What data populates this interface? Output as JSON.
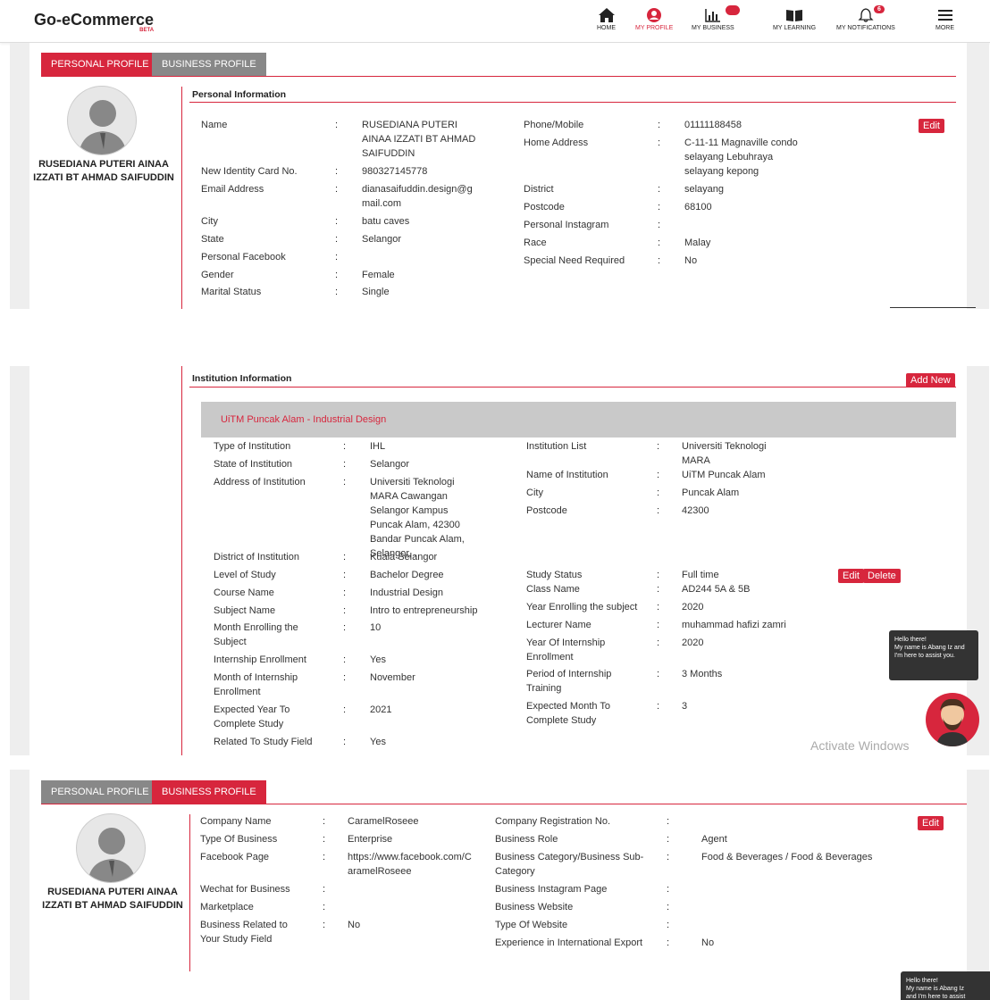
{
  "header": {
    "logo": "Go-eCommerce",
    "beta": "BETA",
    "nav": [
      {
        "label": "HOME",
        "icon": "home-icon"
      },
      {
        "label": "MY PROFILE",
        "icon": "user-icon"
      },
      {
        "label": "MY BUSINESS",
        "icon": "chart-icon",
        "badge": ""
      },
      {
        "label": "MY LEARNING",
        "icon": "book-icon"
      },
      {
        "label": "MY NOTIFICATIONS",
        "icon": "bell-icon",
        "badge": "6"
      },
      {
        "label": "MORE",
        "icon": "menu-icon"
      }
    ]
  },
  "tabs": {
    "personal": "PERSONAL PROFILE",
    "business": "BUSINESS PROFILE"
  },
  "user": {
    "name_line1": "RUSEDIANA PUTERI AINAA",
    "name_line2": "IZZATI BT AHMAD SAIFUDDIN"
  },
  "personal": {
    "section": "Personal Information",
    "edit": "Edit",
    "left": [
      [
        "Name",
        "RUSEDIANA PUTERI AINAA IZZATI BT AHMAD SAIFUDDIN"
      ],
      [
        "New Identity Card No.",
        "980327145778"
      ],
      [
        "Email Address",
        "dianasaifuddin.design@gmail.com"
      ],
      [
        "City",
        "batu caves"
      ],
      [
        "State",
        "Selangor"
      ],
      [
        "Personal Facebook",
        ""
      ],
      [
        "Gender",
        "Female"
      ],
      [
        "Marital Status",
        "Single"
      ]
    ],
    "right": [
      [
        "Phone/Mobile",
        "01111188458"
      ],
      [
        "Home Address",
        "C-11-11 Magnaville condo selayang Lebuhraya selayang kepong"
      ],
      [
        "District",
        "selayang"
      ],
      [
        "Postcode",
        "68100"
      ],
      [
        "Personal Instagram",
        ""
      ],
      [
        "Race",
        "Malay"
      ],
      [
        "Special Need Required",
        "No"
      ]
    ]
  },
  "institution": {
    "section": "Institution Information",
    "add": "Add New",
    "title": "UiTM Puncak Alam - Industrial Design",
    "edit": "Edit",
    "delete": "Delete",
    "left": [
      [
        "Type of Institution",
        "IHL"
      ],
      [
        "State of Institution",
        "Selangor"
      ],
      [
        "Address of Institution",
        "Universiti Teknologi MARA Cawangan Selangor Kampus Puncak Alam, 42300 Bandar Puncak Alam, Selangor, ."
      ],
      [
        "District of Institution",
        "Kuala Selangor"
      ],
      [
        "Level of Study",
        "Bachelor Degree"
      ],
      [
        "Course Name",
        "Industrial Design"
      ],
      [
        "Subject Name",
        "Intro to entrepreneurship"
      ],
      [
        "Month Enrolling the Subject",
        "10"
      ],
      [
        "Internship Enrollment",
        "Yes"
      ],
      [
        "Month of Internship Enrollment",
        "November"
      ],
      [
        "Expected Year To Complete Study",
        "2021"
      ],
      [
        "Related To Study Field",
        "Yes"
      ]
    ],
    "right": [
      [
        "Institution List",
        "Universiti Teknologi MARA"
      ],
      [
        "Name of Institution",
        "UiTM Puncak Alam"
      ],
      [
        "City",
        "Puncak Alam"
      ],
      [
        "Postcode",
        "42300"
      ],
      [
        "Study Status",
        "Full time"
      ],
      [
        "Class Name",
        "AD244 5A & 5B"
      ],
      [
        "Year Enrolling the subject",
        "2020"
      ],
      [
        "Lecturer Name",
        "muhammad hafizi zamri"
      ],
      [
        "Year Of Internship Enrollment",
        "2020"
      ],
      [
        "Period of Internship Training",
        "3 Months"
      ],
      [
        "Expected Month To Complete Study",
        "3"
      ]
    ]
  },
  "business": {
    "edit": "Edit",
    "left": [
      [
        "Company Name",
        "CaramelRoseee"
      ],
      [
        "Type Of Business",
        "Enterprise"
      ],
      [
        "Facebook Page",
        "https://www.facebook.com/CaramelRoseee"
      ],
      [
        "Wechat for Business",
        ""
      ],
      [
        "Marketplace",
        ""
      ],
      [
        "Business Related to Your Study Field",
        "No"
      ]
    ],
    "right": [
      [
        "Company Registration No.",
        ""
      ],
      [
        "Business Role",
        "Agent"
      ],
      [
        "Business Category/Business Sub-Category",
        "Food & Beverages / Food & Beverages"
      ],
      [
        "Business Instagram Page",
        ""
      ],
      [
        "Business Website",
        ""
      ],
      [
        "Type Of Website",
        ""
      ],
      [
        "Experience in International Export",
        "No"
      ]
    ]
  },
  "activate": "Activate Windows",
  "chat": {
    "line1": "Hello there!",
    "line2": "My name is Abang Iz and I'm here to assist you.",
    "line2b": "My name is Abang Iz",
    "line3b": "and I'm here to assist"
  }
}
